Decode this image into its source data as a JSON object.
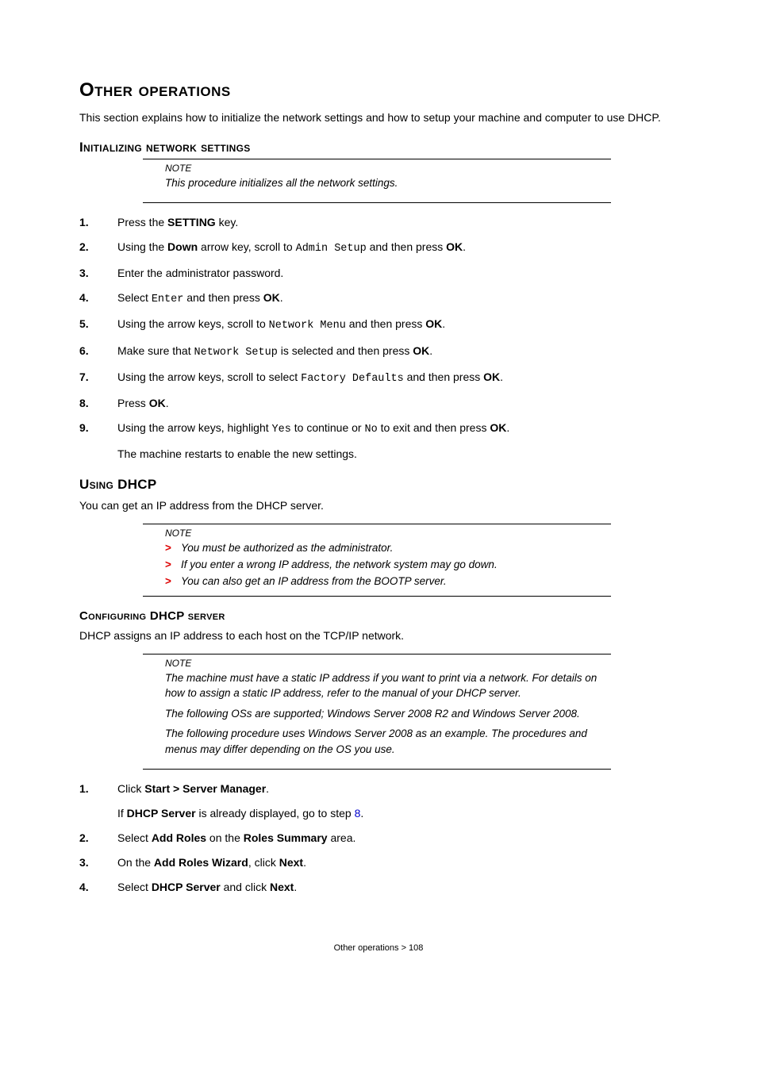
{
  "title": "Other operations",
  "intro": "This section explains how to initialize the network settings and how to setup your machine and computer to use DHCP.",
  "section1": {
    "heading": "Initializing network settings",
    "note_label": "NOTE",
    "note_text": "This procedure initializes all the network settings.",
    "steps": {
      "s1": {
        "num": "1.",
        "pre": "Press the ",
        "b1": "SETTING",
        "post": " key."
      },
      "s2": {
        "num": "2.",
        "pre": "Using the ",
        "b1": "Down",
        "mid1": " arrow key, scroll to ",
        "mono1": "Admin Setup",
        "mid2": " and then press ",
        "b2": "OK",
        "post": "."
      },
      "s3": {
        "num": "3.",
        "text": "Enter the administrator password."
      },
      "s4": {
        "num": "4.",
        "pre": "Select ",
        "mono1": "Enter",
        "mid1": " and then press ",
        "b1": "OK",
        "post": "."
      },
      "s5": {
        "num": "5.",
        "pre": "Using the arrow keys, scroll to ",
        "mono1": "Network Menu",
        "mid1": " and then press ",
        "b1": "OK",
        "post": "."
      },
      "s6": {
        "num": "6.",
        "pre": "Make sure that ",
        "mono1": "Network Setup",
        "mid1": " is selected and then press ",
        "b1": "OK",
        "post": "."
      },
      "s7": {
        "num": "7.",
        "pre": "Using the arrow keys, scroll to select ",
        "mono1": "Factory Defaults",
        "mid1": " and then press ",
        "b1": "OK",
        "post": "."
      },
      "s8": {
        "num": "8.",
        "pre": "Press ",
        "b1": "OK",
        "post": "."
      },
      "s9": {
        "num": "9.",
        "pre": "Using the arrow keys, highlight ",
        "mono1": "Yes",
        "mid1": " to continue or ",
        "mono2": "No",
        "mid2": " to exit and then press ",
        "b1": "OK",
        "post": ".",
        "sub": "The machine restarts to enable the new settings."
      }
    }
  },
  "section2": {
    "heading": "Using DHCP",
    "intro": "You can get an IP address from the DHCP server.",
    "note_label": "NOTE",
    "bullets": {
      "b1": "You must be authorized as the administrator.",
      "b2": "If you enter a wrong IP address, the network system may go down.",
      "b3": "You can also get an IP address from the BOOTP server."
    }
  },
  "section3": {
    "heading": "Configuring DHCP server",
    "intro": "DHCP assigns an IP address to each host on the TCP/IP network.",
    "note_label": "NOTE",
    "note_p1": "The machine must have a static IP address if you want to print via a network. For details on how to assign a static IP address, refer to the manual of your DHCP server.",
    "note_p2": "The following OSs are supported; Windows Server 2008 R2 and Windows Server 2008.",
    "note_p3": "The following procedure uses Windows Server 2008 as an example. The procedures and menus may differ depending on the OS you use.",
    "steps": {
      "s1": {
        "num": "1.",
        "pre": "Click ",
        "b1": "Start > Server Manager",
        "post": ".",
        "sub_pre": "If ",
        "sub_b1": "DHCP Server",
        "sub_mid": " is already displayed, go to step ",
        "sub_link": "8",
        "sub_post": "."
      },
      "s2": {
        "num": "2.",
        "pre": "Select ",
        "b1": "Add Roles",
        "mid1": " on the ",
        "b2": "Roles Summary",
        "post": " area."
      },
      "s3": {
        "num": "3.",
        "pre": "On the ",
        "b1": "Add Roles Wizard",
        "mid1": ", click ",
        "b2": "Next",
        "post": "."
      },
      "s4": {
        "num": "4.",
        "pre": "Select ",
        "b1": "DHCP Server",
        "mid1": " and click ",
        "b2": "Next",
        "post": "."
      }
    }
  },
  "footer": {
    "text": "Other operations > 108"
  }
}
